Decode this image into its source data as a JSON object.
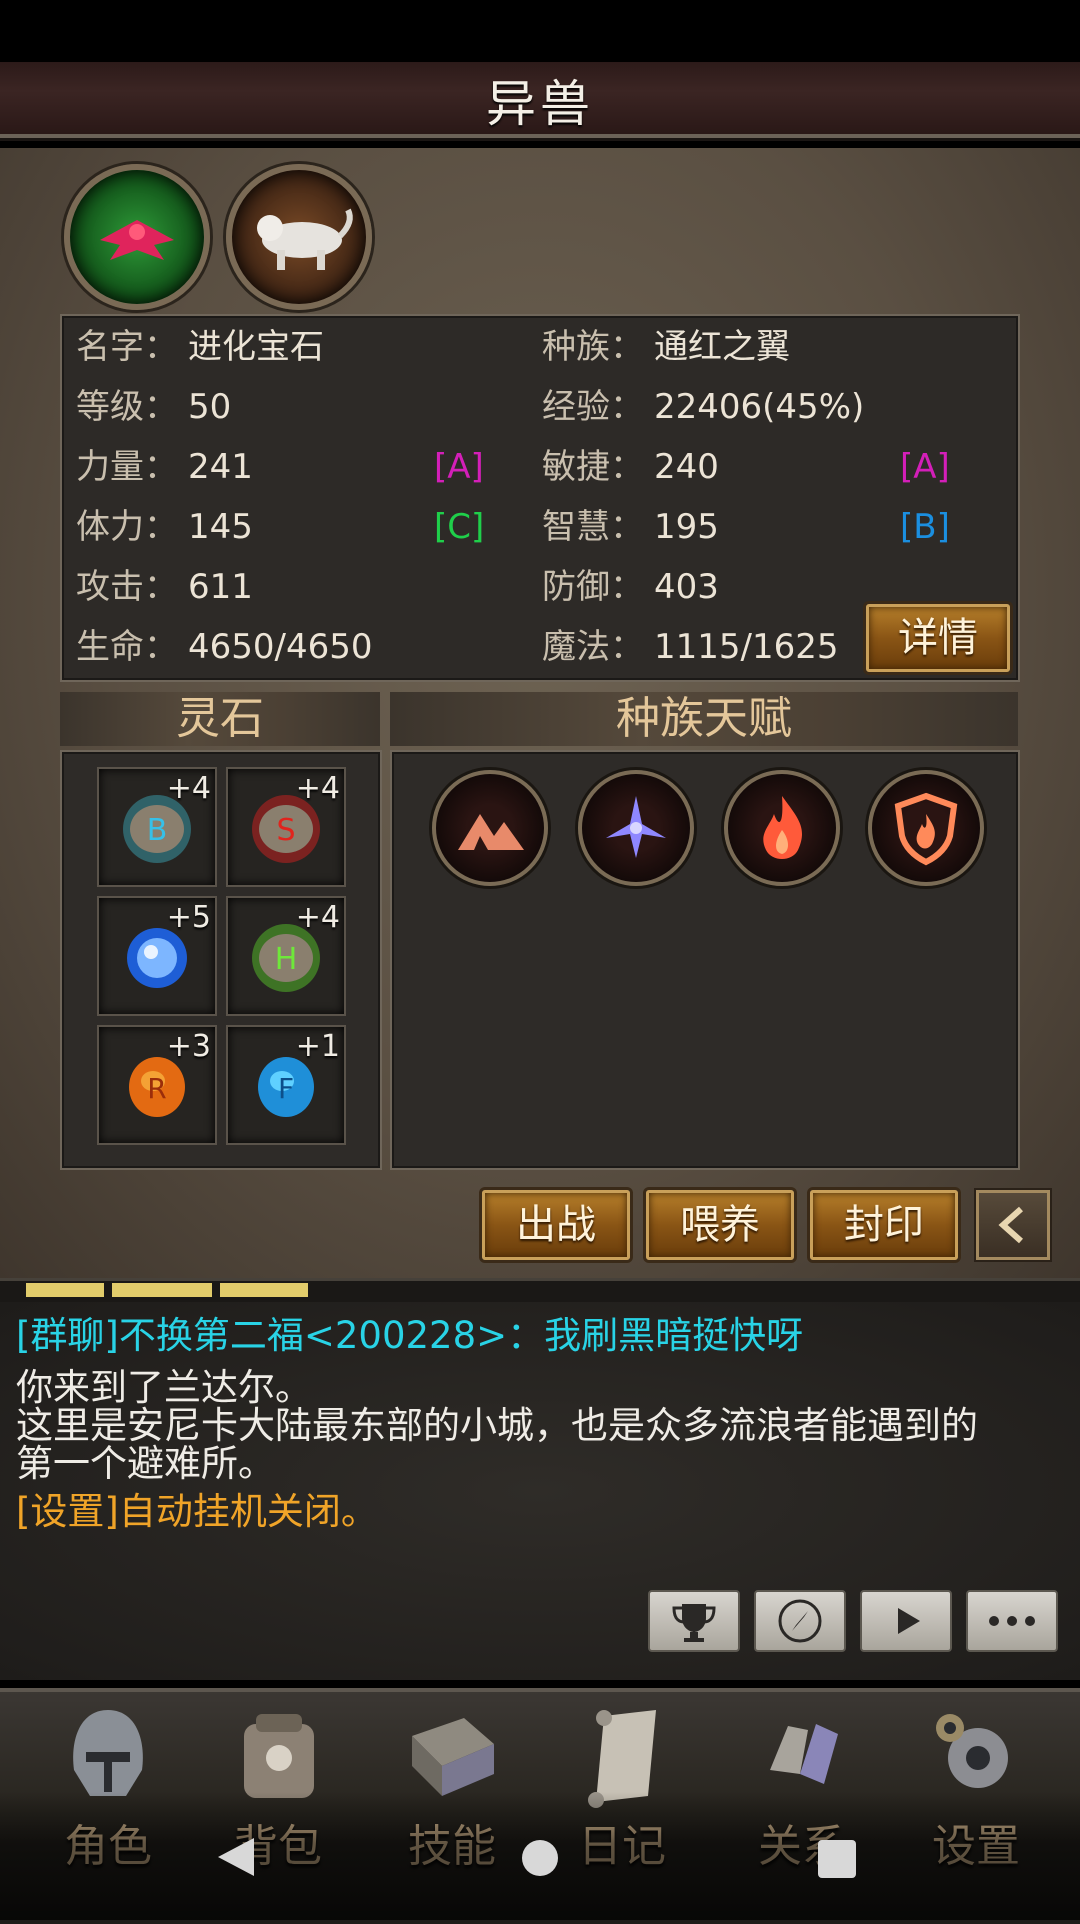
{
  "header": {
    "title": "异兽"
  },
  "beasts": [
    {
      "name": "red-winged-beast-icon",
      "active": true
    },
    {
      "name": "white-tiger-icon",
      "active": false
    }
  ],
  "info": {
    "name_label": "名字：",
    "name_value": "进化宝石",
    "race_label": "种族：",
    "race_value": "通红之翼",
    "level_label": "等级：",
    "level_value": "50",
    "exp_label": "经验：",
    "exp_value": "22406(45%)",
    "str_label": "力量：",
    "str_value": "241",
    "str_grade": "[A]",
    "agi_label": "敏捷：",
    "agi_value": "240",
    "agi_grade": "[A]",
    "vit_label": "体力：",
    "vit_value": "145",
    "vit_grade": "[C]",
    "wis_label": "智慧：",
    "wis_value": "195",
    "wis_grade": "[B]",
    "atk_label": "攻击：",
    "atk_value": "611",
    "def_label": "防御：",
    "def_value": "403",
    "hp_label": "生命：",
    "hp_value": "4650/4650",
    "mp_label": "魔法：",
    "mp_value": "1115/1625",
    "detail_button": "详情"
  },
  "colors": {
    "grade_A": "#d41fb9",
    "grade_C": "#1fcf4a",
    "grade_B": "#1b8fe0",
    "chat_group": "#29d3e6",
    "chat_system": "#f0a428"
  },
  "stones": {
    "title": "灵石",
    "slots": [
      {
        "level": "+4",
        "icon": "blue-rune-stone-icon"
      },
      {
        "level": "+4",
        "icon": "red-rune-stone-icon"
      },
      {
        "level": "+5",
        "icon": "blue-orb-icon"
      },
      {
        "level": "+4",
        "icon": "green-rune-stone-icon"
      },
      {
        "level": "+3",
        "icon": "orange-rune-stone-icon"
      },
      {
        "level": "+1",
        "icon": "cyan-rune-stone-icon"
      }
    ]
  },
  "talents": {
    "title": "种族天赋",
    "items": [
      "mountain-icon",
      "wing-emblem-icon",
      "flame-icon",
      "fire-shield-icon"
    ]
  },
  "actions": {
    "battle": "出战",
    "feed": "喂养",
    "seal": "封印"
  },
  "chat": {
    "line1": "[群聊]不换第二福<200228>：我刷黑暗挺快呀",
    "line2": "你来到了兰达尔。",
    "line3": "这里是安尼卡大陆最东部的小城，也是众多流浪者能遇到的",
    "line4": "第一个避难所。",
    "line5": "[设置]自动挂机关闭。"
  },
  "nav": {
    "character": "角色",
    "bag": "背包",
    "skills": "技能",
    "diary": "日记",
    "relations": "关系",
    "settings": "设置"
  }
}
